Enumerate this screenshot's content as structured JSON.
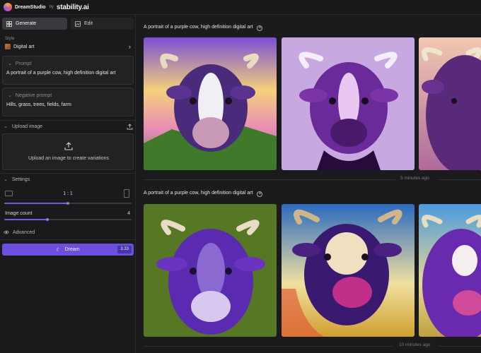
{
  "app": {
    "name": "DreamStudio",
    "by": "by",
    "company": "stability.ai"
  },
  "sidebar": {
    "tabs": [
      {
        "label": "Generate",
        "icon": "grid-icon"
      },
      {
        "label": "Edit",
        "icon": "image-edit-icon"
      }
    ],
    "style": {
      "label": "Style",
      "value": "Digital art"
    },
    "prompt": {
      "title": "Prompt",
      "text": "A portrait of a purple cow, high definition digital art"
    },
    "negative_prompt": {
      "title": "Negative prompt",
      "text": "Hills, grass, trees, fields, farm"
    },
    "upload": {
      "section": "Upload image",
      "text": "Upload an image to create variations"
    },
    "settings": {
      "section": "Settings",
      "ratio": "1 : 1",
      "ratio_level": 0.5,
      "image_count_label": "Image count",
      "image_count": "4",
      "image_count_level": 0.34
    },
    "advanced": "Advanced",
    "dream": {
      "label": "Dream",
      "credits": "3.33"
    }
  },
  "feed": [
    {
      "prompt": "A portrait of a purple cow, high definition digital art",
      "time": "5 minutes ago"
    },
    {
      "prompt": "A portrait of a purple cow, high definition digital art",
      "time": "10 minutes ago"
    }
  ]
}
